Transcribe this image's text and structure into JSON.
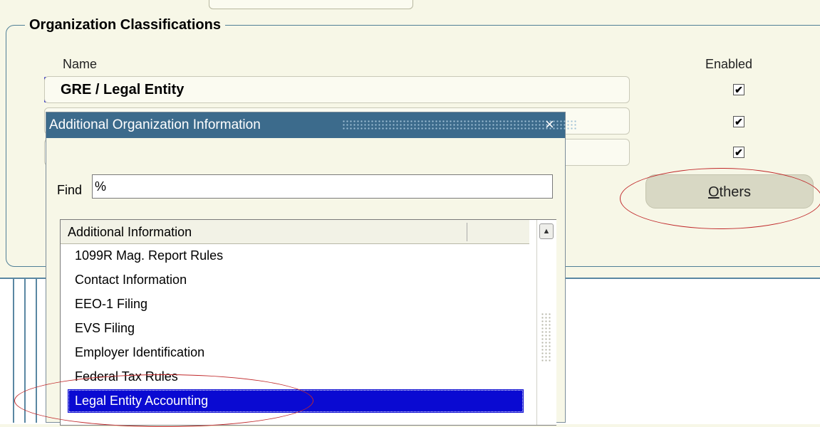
{
  "section": {
    "title": "Organization Classifications"
  },
  "table": {
    "headers": {
      "name": "Name",
      "enabled": "Enabled"
    },
    "rows": [
      {
        "name": "GRE / Legal Entity",
        "enabled": "✔"
      },
      {
        "name": "",
        "enabled": "✔"
      },
      {
        "name": "",
        "enabled": "✔"
      }
    ]
  },
  "buttons": {
    "others": {
      "mnemonic": "O",
      "rest": "thers"
    }
  },
  "dialog": {
    "title": "Additional Organization Information",
    "close": "×",
    "find_label": "Find",
    "find_value": "%",
    "list_header": "Additional Information",
    "items": [
      "1099R Mag. Report Rules",
      "Contact Information",
      "EEO-1 Filing",
      "EVS Filing",
      "Employer Identification",
      "Federal Tax Rules",
      "Legal Entity Accounting"
    ],
    "selected_index": 6,
    "scroll_up": "▲"
  },
  "colors": {
    "background": "#f7f7e7",
    "titlebar": "#3c6b8c",
    "selection": "#0a0ad2",
    "annotation": "#c0282a",
    "row_indicator": "#1616c8"
  }
}
